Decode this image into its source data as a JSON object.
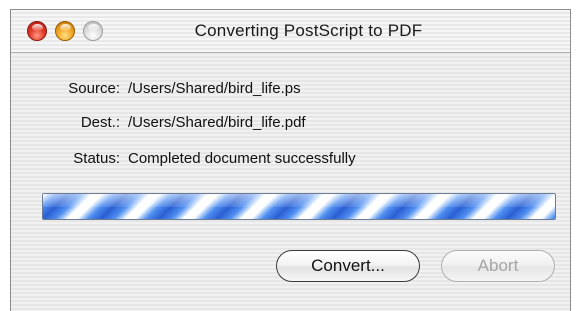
{
  "window": {
    "title": "Converting PostScript to PDF"
  },
  "info": {
    "source_label": "Source:",
    "source_value": "/Users/Shared/bird_life.ps",
    "dest_label": "Dest.:",
    "dest_value": "/Users/Shared/bird_life.pdf",
    "status_label": "Status:",
    "status_value": "Completed document successfully"
  },
  "progress": {
    "state": "indeterminate",
    "fill_fraction": 1.0,
    "color": "#2a5fd3"
  },
  "buttons": {
    "convert_label": "Convert...",
    "abort_label": "Abort",
    "abort_enabled": false
  },
  "icons": {
    "close": "close-button-red",
    "minimize": "minimize-button-yellow",
    "zoom": "zoom-button-gray"
  }
}
